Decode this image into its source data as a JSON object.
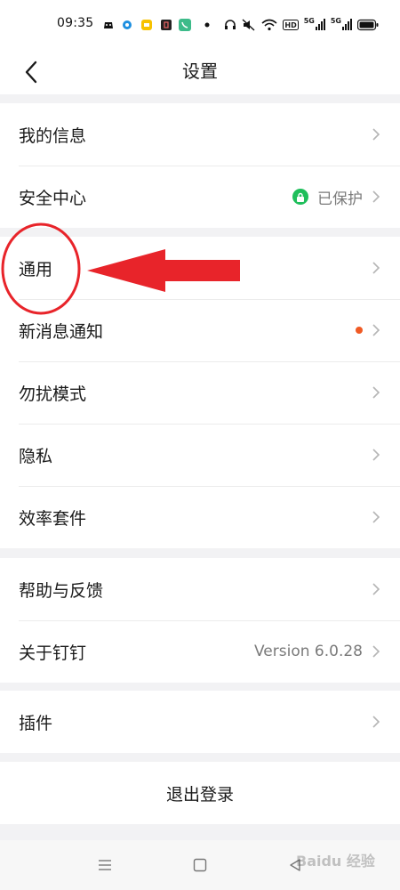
{
  "status_bar": {
    "time": "09:35",
    "icons": [
      "app-bot-icon",
      "blue-circle-icon",
      "yellow-app-icon",
      "dark-app-icon",
      "phone-icon",
      "dot-icon",
      "headset-icon",
      "mute-icon",
      "wifi-icon",
      "hd-icon",
      "5g-signal-icon",
      "5g-signal-icon-2",
      "battery-icon"
    ],
    "hd_text": "HD",
    "net1": "5G",
    "net2": "5G"
  },
  "header": {
    "title": "设置"
  },
  "groups": {
    "g1": [
      {
        "label": "我的信息"
      },
      {
        "label": "安全中心",
        "value": "已保护"
      }
    ],
    "g2": [
      {
        "label": "通用"
      },
      {
        "label": "新消息通知"
      },
      {
        "label": "勿扰模式"
      },
      {
        "label": "隐私"
      },
      {
        "label": "效率套件"
      }
    ],
    "g3": [
      {
        "label": "帮助与反馈"
      },
      {
        "label": "关于钉钉",
        "value": "Version 6.0.28"
      }
    ],
    "g4": [
      {
        "label": "插件"
      }
    ]
  },
  "logout_label": "退出登录",
  "colors": {
    "accent_red": "#e8242a",
    "green_badge": "#1fbf5b",
    "notify_dot": "#f05a24"
  },
  "watermark": "Baidu 经验"
}
